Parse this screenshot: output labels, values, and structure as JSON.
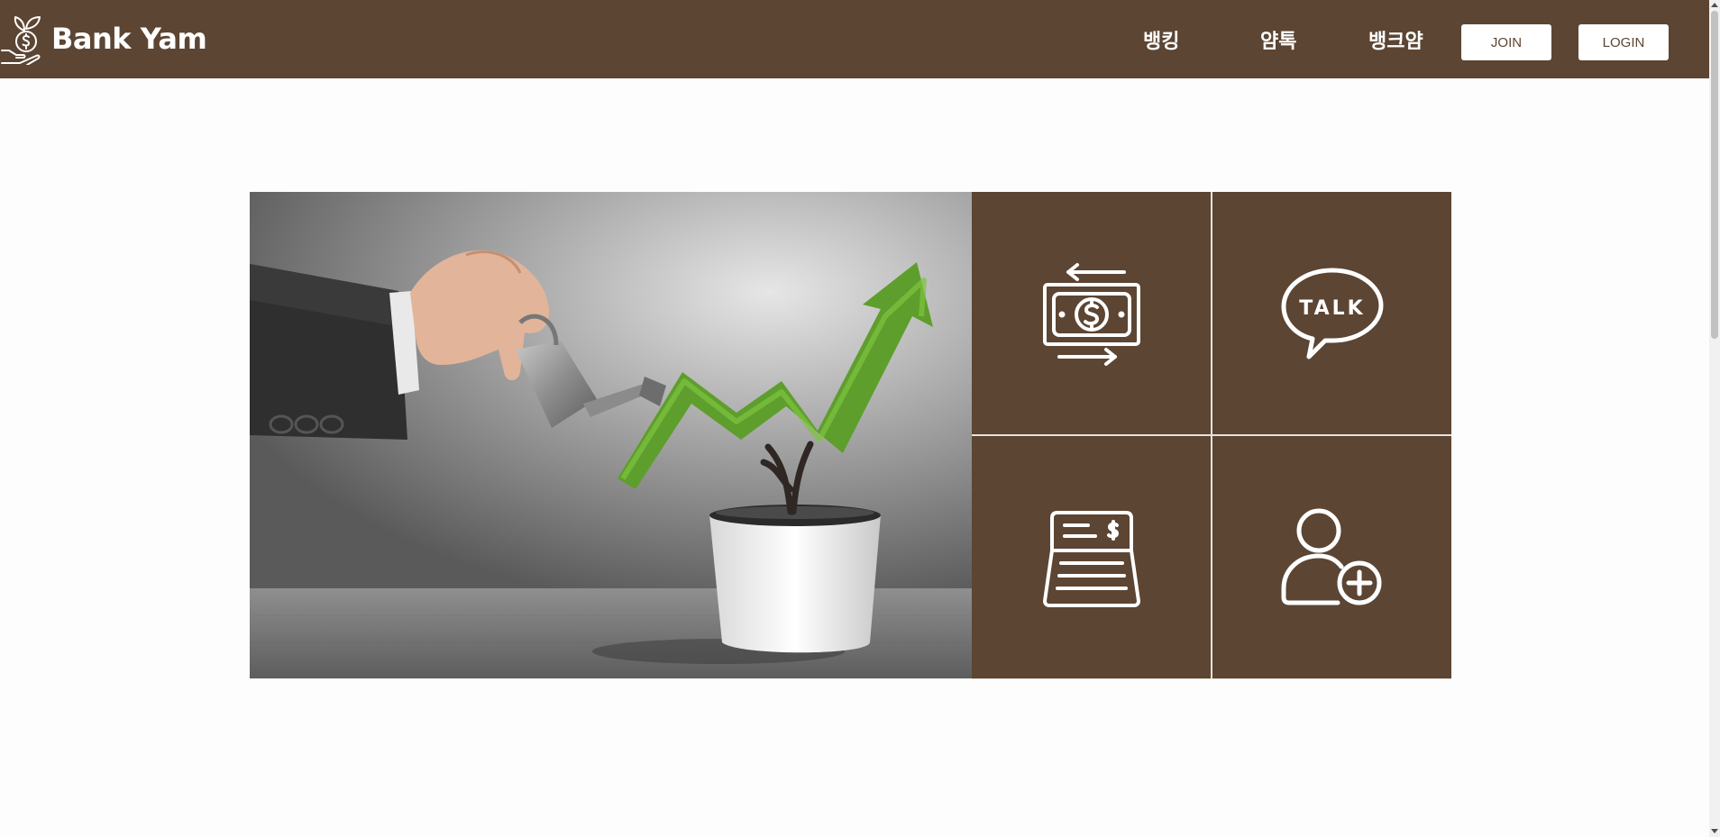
{
  "header": {
    "brand_name": "Bank Yam",
    "brand_icon": "money-plant-hand-icon",
    "background_color": "#5c4533",
    "nav": [
      {
        "label": "뱅킹"
      },
      {
        "label": "얌톡"
      },
      {
        "label": "뱅크얌"
      }
    ],
    "join_label": "JOIN",
    "login_label": "LOGIN"
  },
  "hero": {
    "image": "hand-watering-plant-growth-arrow-image"
  },
  "tiles": [
    {
      "icon": "money-exchange-icon"
    },
    {
      "icon": "talk-bubble-icon",
      "icon_text": "TALK"
    },
    {
      "icon": "receipt-laptop-icon"
    },
    {
      "icon": "add-user-icon"
    }
  ],
  "colors": {
    "primary": "#5c4533",
    "text_on_primary": "#ffffff",
    "background": "#fdfdfd"
  }
}
